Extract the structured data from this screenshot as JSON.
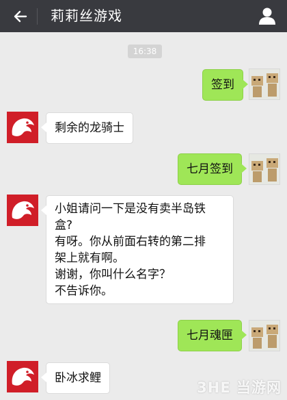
{
  "header": {
    "title": "莉莉丝游戏"
  },
  "time_divider": "16:38",
  "messages": [
    {
      "sender": "me",
      "text": "签到"
    },
    {
      "sender": "other",
      "text": "剩余的龙骑士"
    },
    {
      "sender": "me",
      "text": "七月签到"
    },
    {
      "sender": "other",
      "text": "小姐请问一下是没有卖半岛铁\n盒?\n有呀。你从前面右转的第二排\n架上就有啊。\n谢谢，你叫什么名字？\n不告诉你。"
    },
    {
      "sender": "me",
      "text": "七月魂匣"
    },
    {
      "sender": "other",
      "text": "卧冰求鲤"
    }
  ],
  "watermark": "3HE 当游网",
  "colors": {
    "topbar": "#393a3f",
    "background": "#ebebeb",
    "bubble_me": "#9fe657",
    "bubble_other": "#ffffff",
    "avatar_other": "#d01e28"
  },
  "icons": {
    "back": "back-arrow-icon",
    "contact": "person-icon",
    "avatar_me": "danbo-figures-avatar",
    "avatar_other": "dragon-logo-avatar"
  }
}
